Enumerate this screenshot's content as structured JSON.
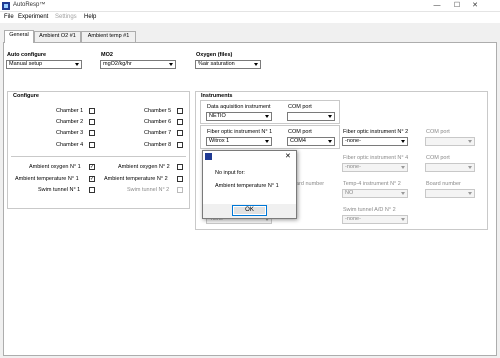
{
  "window": {
    "title": "AutoResp™",
    "minimize": "—",
    "maximize": "☐",
    "close": "✕"
  },
  "menu": [
    "File",
    "Experiment",
    "Settings",
    "Help"
  ],
  "tabs": [
    "General",
    "Ambient O2 #1",
    "Ambient temp #1"
  ],
  "general": {
    "auto_configure_label": "Auto configure",
    "auto_configure_value": "Manual setup",
    "mo2_label": "MO2",
    "mo2_value": "mgO2/kg/hr",
    "oxygen_label": "Oxygen (files)",
    "oxygen_value": "%air saturation"
  },
  "configure": {
    "title": "Configure",
    "chambers_left": [
      "Chamber 1",
      "Chamber 2",
      "Chamber 3",
      "Chamber 4"
    ],
    "chambers_right": [
      "Chamber 5",
      "Chamber 6",
      "Chamber 7",
      "Chamber 8"
    ],
    "sensors_left": [
      {
        "label": "Ambient oxygen N° 1",
        "checked": "✓"
      },
      {
        "label": "Ambient temperature N° 1",
        "checked": "✓"
      },
      {
        "label": "Swim tunnel N° 1",
        "checked": ""
      }
    ],
    "sensors_right": [
      {
        "label": "Ambient oxygen N° 2",
        "checked": ""
      },
      {
        "label": "Ambient temperature N° 2",
        "checked": ""
      },
      {
        "label": "Swim tunnel N° 2",
        "checked": ""
      }
    ]
  },
  "instruments": {
    "title": "Instruments",
    "daq_label": "Data aquisition instrument",
    "daq_value": "NETIO",
    "com_port_label": "COM port",
    "daq_com_value": "",
    "fiber1_label": "Fiber optic instrument N° 1",
    "fiber1_value": "Witrox 1",
    "fiber1_com_label": "COM port",
    "fiber1_com_value": "COM4",
    "fiber2_label": "Fiber optic instrument N° 2",
    "fiber2_value": "-none-",
    "fiber2_com_label": "COM port",
    "fiber2_com_value": "",
    "fiber4_label": "Fiber optic instrument N° 4",
    "fiber4_value": "-none-",
    "fiber4_com_label": "COM port",
    "fiber4_com_value": "",
    "board1_label": "ard number",
    "temp2_label": "Temp-4 instrument N° 2",
    "temp2_value": "NO",
    "board2_label": "Board number",
    "board2_value": "",
    "swim2_label": "Swim tunnel A/D N° 2",
    "swim2_value": "-none-",
    "swim1_value": "-none-"
  },
  "dialog": {
    "message_line1": "No input for:",
    "message_line2": "Ambient temperature N° 1",
    "ok_label": "OK",
    "close": "✕"
  }
}
